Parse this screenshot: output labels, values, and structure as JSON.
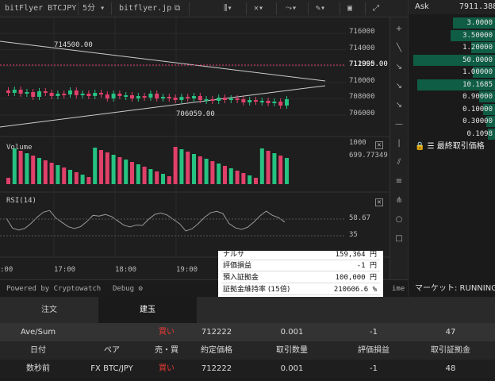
{
  "toolbar": {
    "symbol": "bitFlyer BTCJPY",
    "interval": "5分",
    "exchange_link": "bitflyer.jp"
  },
  "chart": {
    "price_axis": [
      "716000",
      "714000",
      "712000",
      "710000",
      "708000",
      "706000"
    ],
    "last_price": "711995.00",
    "high_label": "714500.00",
    "low_label": "706059.00",
    "volume_title": "Volume",
    "volume_axis_top": "1000",
    "volume_value": "699.77349",
    "rsi_title": "RSI(14)",
    "rsi_upper": "58.67",
    "rsi_lower": "35",
    "time_axis": [
      ":00",
      "17:00",
      "18:00",
      "19:00"
    ]
  },
  "footer": {
    "powered": "Powered by Cryptowatch",
    "debug": "Debug ⚙",
    "time_partial": "ime"
  },
  "popup": {
    "rows": [
      {
        "label": "ナルサ",
        "value": "159,364 円"
      },
      {
        "label": "評価損益",
        "value": "-1 円"
      },
      {
        "label": "預入証拠金",
        "value": "100,000 円"
      },
      {
        "label": "証拠金維持率 (15倍)",
        "value": "210606.6 %"
      }
    ]
  },
  "orderbook": {
    "ask_label": "Ask",
    "ask_price": "7911.388",
    "levels": [
      {
        "size": "3.0000",
        "depth": 0.52
      },
      {
        "size": "3.50000",
        "depth": 0.55
      },
      {
        "size": "1.20000",
        "depth": 0.3
      },
      {
        "size": "50.0000",
        "depth": 1.0
      },
      {
        "size": "1.00000",
        "depth": 0.28
      },
      {
        "size": "10.1685",
        "depth": 0.95
      },
      {
        "size": "0.90000",
        "depth": 0.2
      },
      {
        "size": "0.10000",
        "depth": 0.15
      },
      {
        "size": "0.30000",
        "depth": 0.12
      },
      {
        "size": "0.1098",
        "depth": 0.1
      }
    ],
    "last_trade_label": "最終取引価格",
    "market_status": "マーケット: RUNNING"
  },
  "tabs": [
    {
      "label": "注文",
      "active": false
    },
    {
      "label": "建玉",
      "active": true
    }
  ],
  "positions": {
    "summary": {
      "label": "Ave/Sum",
      "side": "買い",
      "price": "712222",
      "qty": "0.001",
      "pnl": "-1",
      "margin": "47"
    },
    "headers": [
      "日付",
      "ペア",
      "売・買",
      "約定価格",
      "取引数量",
      "評価損益",
      "取引証拠金"
    ],
    "rows": [
      {
        "date": "数秒前",
        "pair": "FX BTC/JPY",
        "side": "買い",
        "price": "712222",
        "qty": "0.001",
        "pnl": "-1",
        "margin": "48"
      }
    ]
  },
  "colors": {
    "bull": "#26c281",
    "bear": "#e0406a",
    "accent": "#1e90ff"
  }
}
